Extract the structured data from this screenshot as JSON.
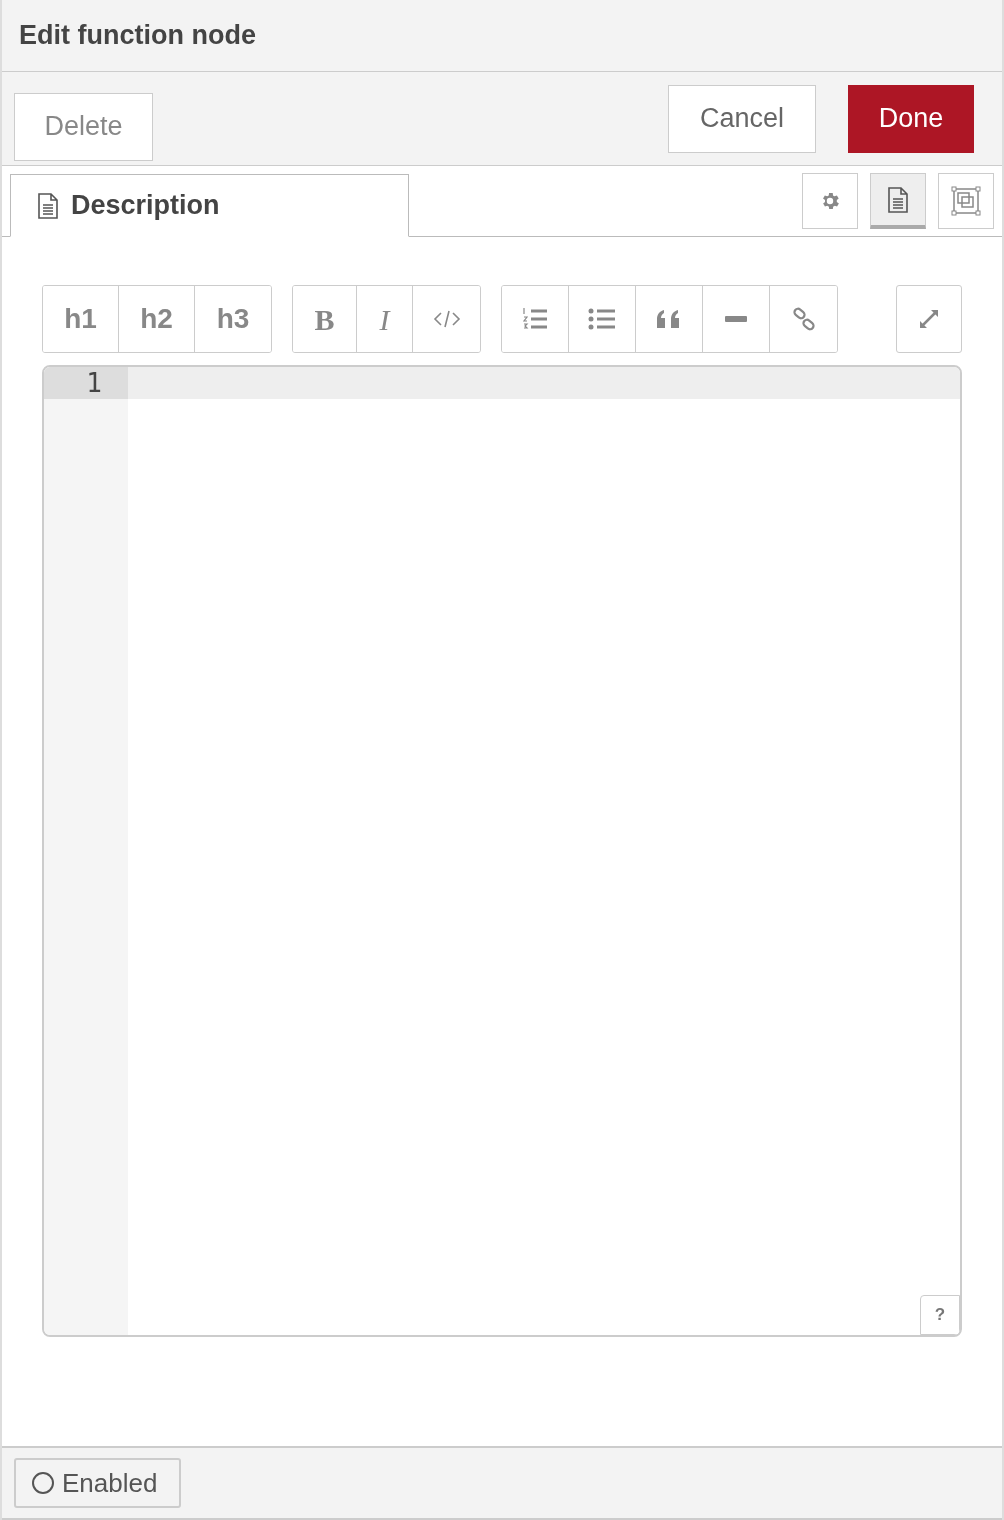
{
  "window": {
    "title": "Edit function node"
  },
  "actions": {
    "delete": "Delete",
    "cancel": "Cancel",
    "done": "Done"
  },
  "tab": {
    "label": "Description",
    "selected": true
  },
  "side_tabs": [
    {
      "kind": "gear",
      "selected": false
    },
    {
      "kind": "document",
      "selected": true
    },
    {
      "kind": "frames",
      "selected": false
    }
  ],
  "toolbar": [
    [
      {
        "kind": "heading",
        "label": "h1"
      },
      {
        "kind": "heading",
        "label": "h2"
      },
      {
        "kind": "heading",
        "label": "h3"
      }
    ],
    [
      {
        "kind": "bold",
        "label": "B"
      },
      {
        "kind": "italic",
        "label": "I"
      },
      {
        "kind": "code"
      }
    ],
    [
      {
        "kind": "olist"
      },
      {
        "kind": "ulist"
      },
      {
        "kind": "quote"
      },
      {
        "kind": "rule"
      },
      {
        "kind": "link"
      }
    ]
  ],
  "expand": {
    "kind": "expand"
  },
  "editor": {
    "lines": [
      "1"
    ],
    "help": "?"
  },
  "footer": {
    "label": "Enabled",
    "on": false
  }
}
